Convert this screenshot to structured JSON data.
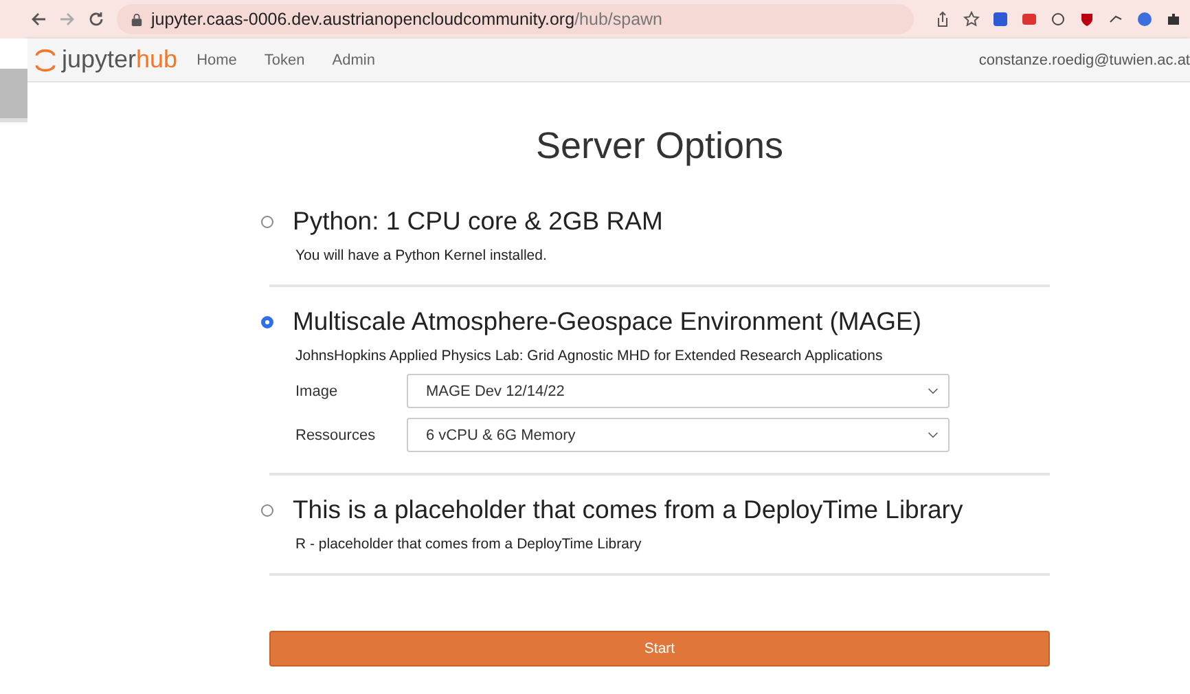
{
  "browser": {
    "url_host": "jupyter.caas-0006.dev.austrianopencloudcommunity.org",
    "url_path": "/hub/spawn"
  },
  "navbar": {
    "logo_word": "jupyter",
    "logo_suffix": "hub",
    "links": [
      "Home",
      "Token",
      "Admin"
    ],
    "user": "constanze.roedig@tuwien.ac.at"
  },
  "title": "Server Options",
  "options": [
    {
      "selected": false,
      "title": "Python: 1 CPU core & 2GB RAM",
      "description": "You will have a Python Kernel installed."
    },
    {
      "selected": true,
      "title": "Multiscale Atmosphere-Geospace Environment (MAGE)",
      "description": "JohnsHopkins Applied Physics Lab: Grid Agnostic MHD for Extended Research Applications",
      "fields": [
        {
          "label": "Image",
          "value": "MAGE Dev 12/14/22"
        },
        {
          "label": "Ressources",
          "value": "6 vCPU & 6G Memory"
        }
      ]
    },
    {
      "selected": false,
      "title": "This is a placeholder that comes from a DeployTime Library",
      "description": "R - placeholder that comes from a DeployTime Library"
    }
  ],
  "start_button": "Start"
}
